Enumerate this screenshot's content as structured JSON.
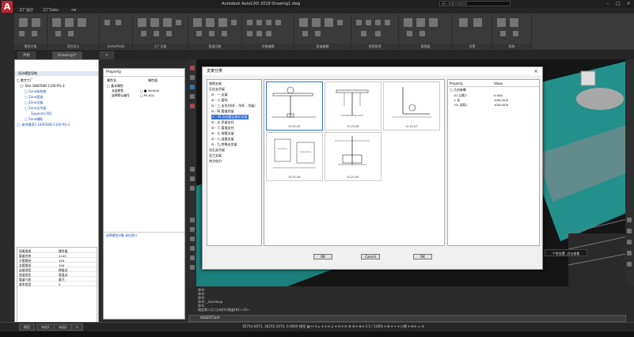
{
  "app": {
    "title": "Autodesk AutoCAD 2018   Drawing1.dwg",
    "search_placeholder": "键入关键字或短语",
    "logo": "A"
  },
  "ribbon_tabs": [
    "工厂设计",
    "工厂Data",
    "⊙▾"
  ],
  "ribbon_groups": [
    {
      "label": "模型对象"
    },
    {
      "label": "项目显示"
    },
    {
      "label": "Undo/Redo"
    },
    {
      "label": "工厂设备"
    },
    {
      "label": "管道功能"
    },
    {
      "label": "对象编辑"
    },
    {
      "label": "管道编辑"
    },
    {
      "label": "视图管理"
    },
    {
      "label": "管理器"
    },
    {
      "label": "设置"
    },
    {
      "label": "帮助"
    }
  ],
  "file_tabs": [
    {
      "label": "开始"
    },
    {
      "label": "Drawing1*"
    },
    {
      "label": "+"
    }
  ],
  "left_panel": {
    "header": "设计模型导航",
    "tree": [
      {
        "label": "□ 数字工厂",
        "blue": false
      },
      {
        "label": "□- Site-180058D-1150-PG-3",
        "blue": false
      },
      {
        "label": "□ Zone结构物",
        "blue": true
      },
      {
        "label": "□ Zone管道",
        "blue": true
      },
      {
        "label": "□ Zone设备",
        "blue": true
      },
      {
        "label": "□ Zone支吊架",
        "blue": true
      },
      {
        "label": "Supports-001",
        "blue": true
      },
      {
        "label": "□ Zone辅助",
        "blue": true
      },
      {
        "label": "□- 参考模型1-180058D-1150-PG-2",
        "blue": true
      }
    ],
    "props": [
      {
        "k": "所属系统",
        "v": "属性值"
      },
      {
        "k": "管道名称",
        "v": "2143"
      },
      {
        "k": "主管管径",
        "v": "100"
      },
      {
        "k": "支管管径",
        "v": "100"
      },
      {
        "k": "连接类型",
        "v": "焊接试"
      },
      {
        "k": "保温类型",
        "v": "保温试"
      },
      {
        "k": "管道介质",
        "v": "蒸汽"
      },
      {
        "k": "其余类型",
        "v": "0"
      }
    ]
  },
  "mid_panel": {
    "header": "Property",
    "col_name": "属性名",
    "col_value": "属性值",
    "group": "□ 基本属性",
    "rows": [
      {
        "k": "支架颜色",
        "v": "□ ■ 000000"
      },
      {
        "k": "选择默认编号",
        "v": "□ PS-001"
      }
    ],
    "footer": "选择模型对象  请在视口"
  },
  "dialog": {
    "title": "支架分类",
    "close": "×",
    "tree": [
      {
        "label": "按照支架",
        "sel": false
      },
      {
        "label": "石化支吊架",
        "sel": false
      },
      {
        "label": "⊟ - 一.支架",
        "sel": false
      },
      {
        "label": "⊟ - 二.管托",
        "sel": false
      },
      {
        "label": "⊟ - 三.支吊(吊杆、吊杆、吊架)",
        "sel": false
      },
      {
        "label": "⊟ - 四.管道吊架",
        "sel": false
      },
      {
        "label": "⊟ - 四.导向管及限位支架",
        "sel": true
      },
      {
        "label": "⊟ - 五.吊架支托",
        "sel": false
      },
      {
        "label": "⊟ - 六.管道支托",
        "sel": false
      },
      {
        "label": "⊟ - 七.保管支架",
        "sel": false
      },
      {
        "label": "⊟ - 八.连接支架",
        "sel": false
      },
      {
        "label": "⊟ - 九.特殊支吊架",
        "sel": false
      },
      {
        "label": "化石支吊架",
        "sel": false
      },
      {
        "label": "化工支架",
        "sel": false
      },
      {
        "label": "热力电力",
        "sel": false
      }
    ],
    "thumbs": [
      {
        "label": "SI-15-05",
        "sel": true
      },
      {
        "label": "SI-15-06",
        "sel": false
      },
      {
        "label": "SI-15-07",
        "sel": false
      },
      {
        "label": "SI-15-08",
        "sel": false
      },
      {
        "label": "SI-15-09",
        "sel": false
      }
    ],
    "props": {
      "col_property": "Property",
      "col_value": "Value",
      "group": "□ 几何参数",
      "rows": [
        {
          "k": "E1 边距1",
          "v": "0.000"
        },
        {
          "k": "L 长",
          "v": "1000.000"
        },
        {
          "k": "H1 边距2",
          "v": "1000.000"
        }
      ]
    },
    "buttons": {
      "ok1": "OK",
      "cancel": "Cancel",
      "ok2": "OK"
    }
  },
  "tooltip": "个性设置, 点击查看",
  "command": {
    "lines": [
      "命令:",
      "命令:",
      "命令:",
      "命令:  _insertsup",
      "命令:",
      "选择 ["
    ],
    "prompt_line": "指定第二点 [方向(V)/角度(N)] <0>:",
    "input": "INSERTSUP"
  },
  "status": {
    "tabs": [
      "模型",
      "布局1",
      "布局2",
      "+"
    ],
    "coords": "35754.6673, 36255.5474, 0.0000   模型  ▦  ⁞⁞⁞  ▾  ⊾  ▾  ⊙  ▾  ∠  ▾  ⊡  ▾  ≡  ☰  ⊕  ▾  ⊗  ▾  1:1 / 100%  ▾  ⚙  ▾  +  ▾  小数  ▾  ⊞  ▾  ▭  ≡"
  }
}
